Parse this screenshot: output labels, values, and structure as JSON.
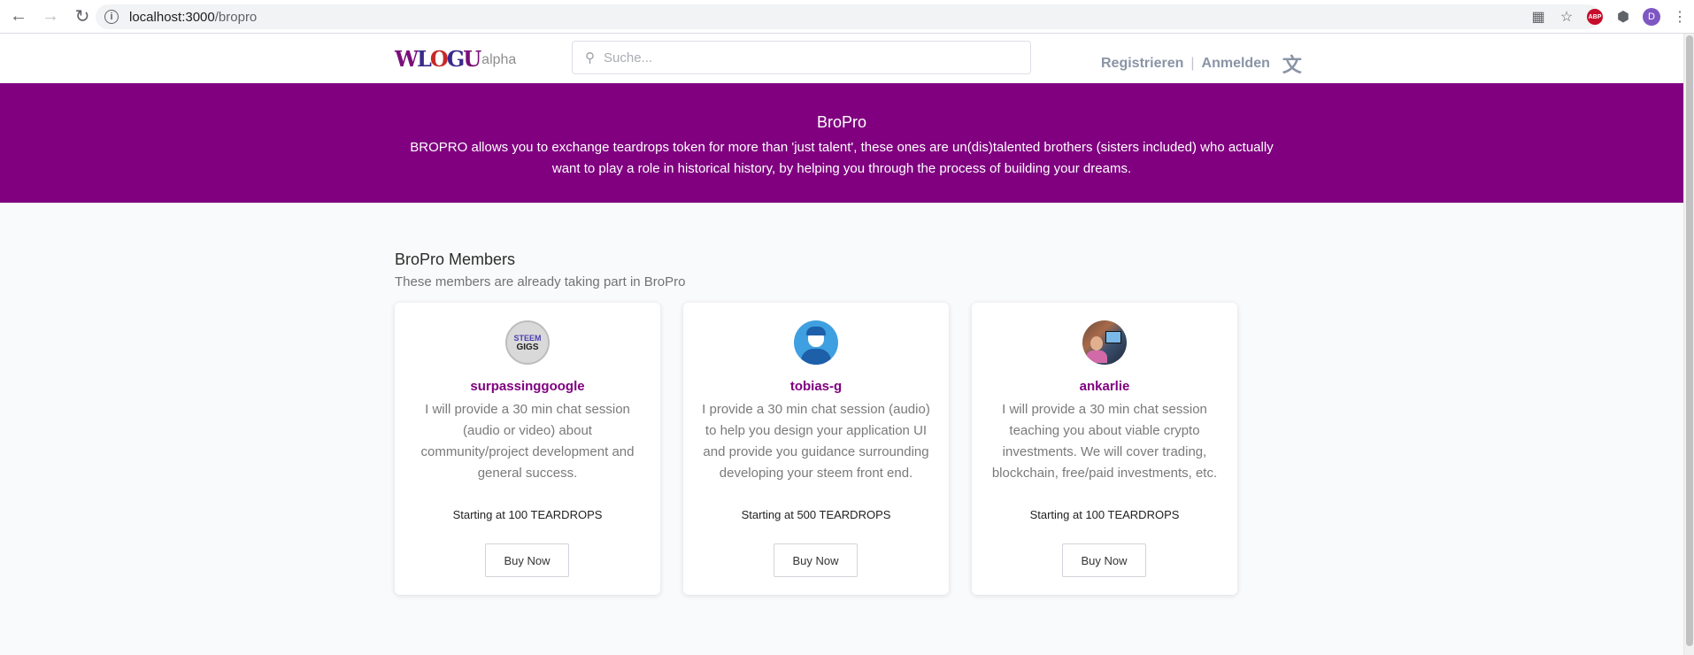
{
  "browser": {
    "url_host": "localhost:3000",
    "url_path": "/bropro",
    "profile_initial": "D",
    "abp_label": "ABP"
  },
  "header": {
    "logo_text_a": "W",
    "logo_text_b": "L",
    "logo_text_c": "O",
    "logo_text_d": "G",
    "logo_text_e": "U",
    "logo_alpha": "alpha",
    "search_placeholder": "Suche...",
    "register_label": "Registrieren",
    "separator": "|",
    "login_label": "Anmelden"
  },
  "banner": {
    "title": "BroPro",
    "description": "BROPRO allows you to exchange teardrops token for more than 'just talent', these ones are un(dis)talented brothers (sisters included) who actually want to play a role in historical history, by helping you through the process of building your dreams.",
    "background_color": "#800080"
  },
  "section": {
    "title": "BroPro Members",
    "subtitle": "These members are already taking part in BroPro"
  },
  "members": [
    {
      "name": "surpassinggoogle",
      "avatar_text_top": "STEEM",
      "avatar_text_bottom": "GIGS",
      "description": "I will provide a 30 min chat session (audio or video) about community/project development and general success.",
      "price": "Starting at 100 TEARDROPS",
      "button_label": "Buy Now"
    },
    {
      "name": "tobias-g",
      "description": "I provide a 30 min chat session (audio) to help you design your application UI and provide you guidance surrounding developing your steem front end.",
      "price": "Starting at 500 TEARDROPS",
      "button_label": "Buy Now"
    },
    {
      "name": "ankarlie",
      "description": "I will provide a 30 min chat session teaching you about viable crypto investments. We will cover trading, blockchain, free/paid investments, etc.",
      "price": "Starting at 100 TEARDROPS",
      "button_label": "Buy Now"
    }
  ],
  "colors": {
    "accent": "#800080",
    "muted_text": "#7a7a7a"
  }
}
